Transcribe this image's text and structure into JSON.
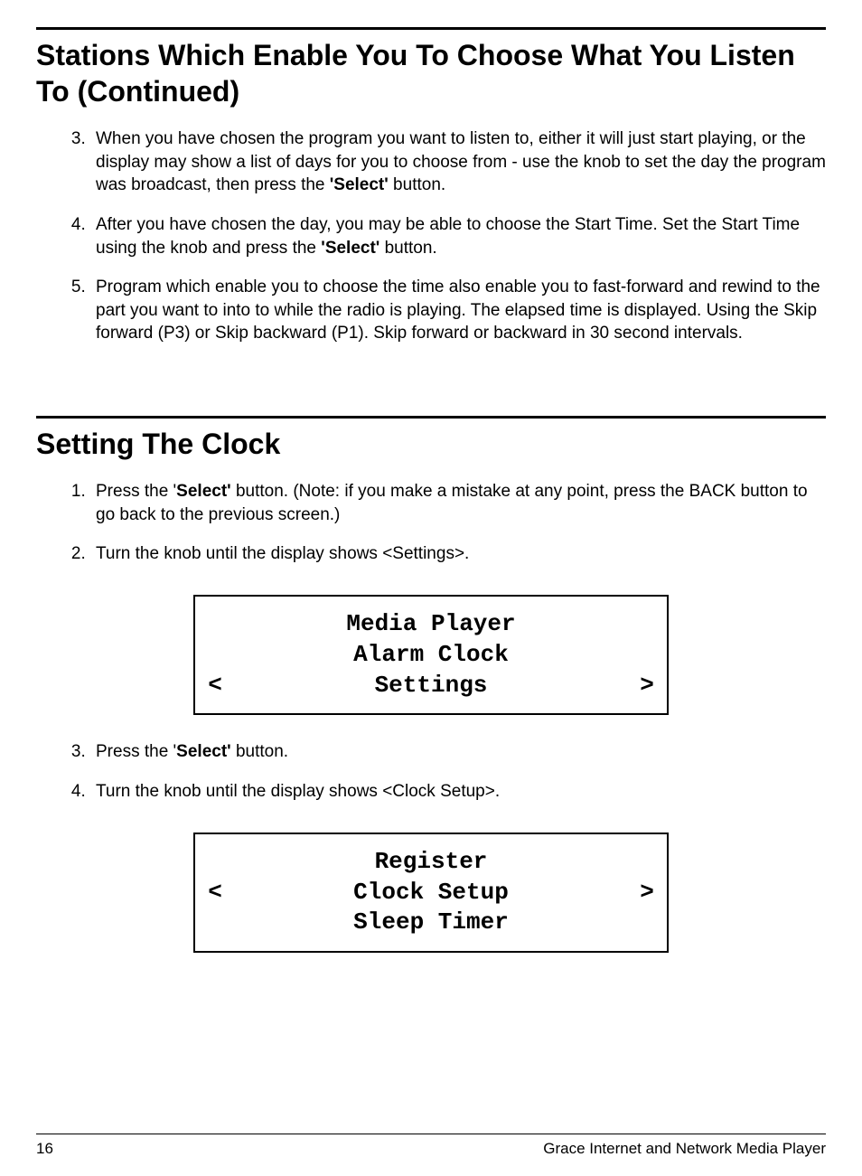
{
  "section1": {
    "heading": "Stations Which Enable You To Choose What You Listen To (Continued)",
    "items": [
      {
        "marker": "3.",
        "pre": "When you have chosen the program you want to listen to, either it will just start playing, or the display may show a list of days for you to choose from - use the knob to set the day the program was broadcast, then press the ",
        "bold": "'Select'",
        "post": " button."
      },
      {
        "marker": "4.",
        "pre": "After you have chosen the day, you may be able to choose the Start Time. Set the Start Time using the knob and press the ",
        "bold": "'Select'",
        "post": " button."
      },
      {
        "marker": "5.",
        "pre": "Program which enable you to choose the time also enable you to fast-forward and rewind to the part you want to into to while the radio is playing.  The elapsed time is displayed. Using the Skip forward (P3) or Skip backward (P1).  Skip forward or backward in 30 second intervals.",
        "bold": "",
        "post": ""
      }
    ]
  },
  "section2": {
    "heading": "Setting The Clock",
    "item1": {
      "marker": "1.",
      "pre": "Press the '",
      "bold": "Select'",
      "post": " button. (Note: if you make a mistake at any point, press the BACK button to go back to the previous screen.)"
    },
    "item2": {
      "marker": "2.",
      "text": "Turn the knob until the display shows <Settings>."
    },
    "display1": {
      "line1": "Media Player",
      "line2": "Alarm Clock",
      "line3_left": "<",
      "line3_mid": "Settings",
      "line3_right": ">"
    },
    "item3": {
      "marker": "3.",
      "pre": "Press the '",
      "bold": "Select'",
      "post": " button."
    },
    "item4": {
      "marker": "4.",
      "text": "Turn the knob until the display shows <Clock Setup>."
    },
    "display2": {
      "line1": "Register",
      "line2_left": "<",
      "line2_mid": "Clock Setup",
      "line2_right": ">",
      "line3": "Sleep Timer"
    }
  },
  "footer": {
    "page": "16",
    "title": "Grace Internet and Network Media Player"
  }
}
